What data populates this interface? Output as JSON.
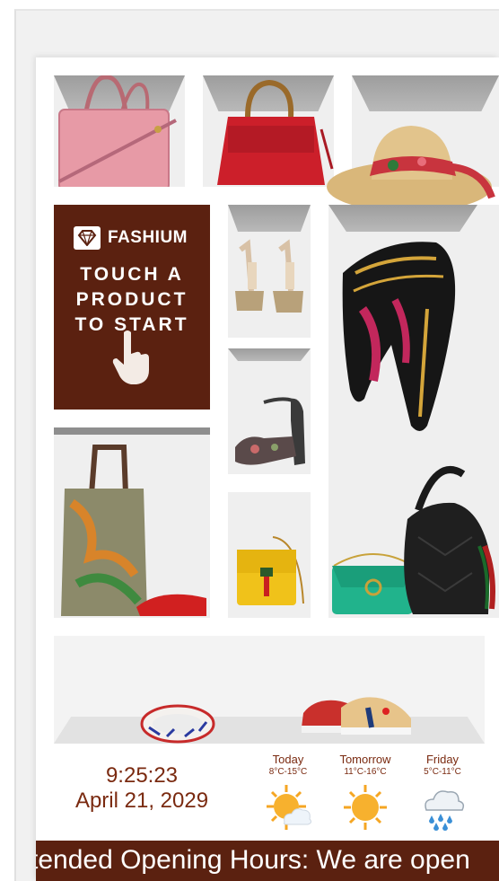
{
  "brand": {
    "name": "FASHIUM"
  },
  "promo": {
    "lines": [
      "TOUCH A",
      "PRODUCT",
      "TO START"
    ]
  },
  "clock": {
    "time": "9:25:23",
    "date": "April 21, 2029"
  },
  "weather": [
    {
      "day": "Today",
      "range": "8°C-15°C",
      "icon": "sun-cloud-icon"
    },
    {
      "day": "Tomorrow",
      "range": "11°C-16°C",
      "icon": "sun-icon"
    },
    {
      "day": "Friday",
      "range": "5°C-11°C",
      "icon": "rain-cloud-icon"
    }
  ],
  "ticker": {
    "text": "tended Opening Hours: We are open"
  },
  "colors": {
    "brand_brown": "#5b2110",
    "text_brown": "#7a2a10",
    "sun": "#f5a623"
  }
}
